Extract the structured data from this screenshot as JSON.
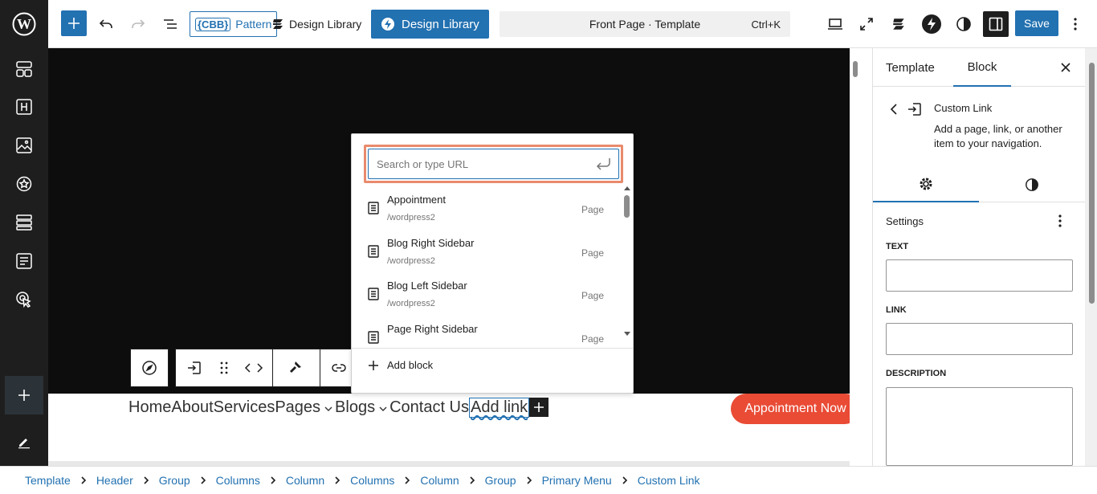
{
  "toolbar": {
    "pattern_prefix": "{CBB}",
    "pattern_label": "Pattern",
    "design_library_1": "Design Library",
    "design_library_2": "Design Library",
    "document_title": "Front Page · Template",
    "shortcut": "Ctrl+K",
    "save_label": "Save"
  },
  "navigation": {
    "items": [
      "Home",
      "About",
      "Services",
      "Pages",
      "Blogs",
      "Contact Us"
    ],
    "add_link": "Add link",
    "cta": "Appointment Now"
  },
  "link_popover": {
    "placeholder": "Search or type URL",
    "results": [
      {
        "title": "Appointment",
        "url": "/wordpress2",
        "kind": "Page"
      },
      {
        "title": "Blog Right Sidebar",
        "url": "/wordpress2",
        "kind": "Page"
      },
      {
        "title": "Blog Left Sidebar",
        "url": "/wordpress2",
        "kind": "Page"
      },
      {
        "title": "Page Right Sidebar",
        "url": "",
        "kind": "Page"
      }
    ],
    "add_block": "Add block"
  },
  "sidebar": {
    "tab_template": "Template",
    "tab_block": "Block",
    "block_title": "Custom Link",
    "block_desc": "Add a page, link, or another item to your navigation.",
    "settings_label": "Settings",
    "text_label": "TEXT",
    "link_label": "LINK",
    "description_label": "DESCRIPTION"
  },
  "breadcrumb": [
    "Template",
    "Header",
    "Group",
    "Columns",
    "Column",
    "Columns",
    "Column",
    "Group",
    "Primary Menu",
    "Custom Link"
  ],
  "colors": {
    "accent": "#2271b1",
    "cta": "#e94b35",
    "search_highlight": "#e98a6d"
  }
}
